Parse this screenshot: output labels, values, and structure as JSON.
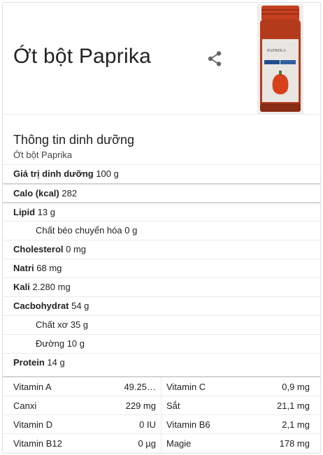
{
  "header": {
    "title": "Ớt bột Paprika",
    "image_label": "PAPRIKA"
  },
  "nutrition": {
    "heading": "Thông tin dinh dưỡng",
    "subheading": "Ớt bột Paprika",
    "rows": [
      {
        "label": "Giá trị dinh dưỡng",
        "value": "100 g",
        "bold": true
      },
      {
        "label": "Calo (kcal)",
        "value": "282",
        "bold": true
      },
      {
        "label": "Lipid",
        "value": "13 g",
        "bold": true
      },
      {
        "label": "Chất béo chuyển hóa",
        "value": "0 g",
        "bold": false
      },
      {
        "label": "Cholesterol",
        "value": "0 mg",
        "bold": true
      },
      {
        "label": "Natri",
        "value": "68 mg",
        "bold": true
      },
      {
        "label": "Kali",
        "value": "2.280 mg",
        "bold": true
      },
      {
        "label": "Cacbohydrat",
        "value": "54 g",
        "bold": true
      },
      {
        "label": "Chất xơ",
        "value": "35 g",
        "bold": false
      },
      {
        "label": "Đường",
        "value": "10 g",
        "bold": false
      },
      {
        "label": "Protein",
        "value": "14 g",
        "bold": true
      }
    ]
  },
  "vitamins": [
    [
      {
        "name": "Vitamin A",
        "value": "49.25…"
      },
      {
        "name": "Vitamin C",
        "value": "0,9 mg"
      }
    ],
    [
      {
        "name": "Canxi",
        "value": "229 mg"
      },
      {
        "name": "Sắt",
        "value": "21,1 mg"
      }
    ],
    [
      {
        "name": "Vitamin D",
        "value": "0 IU"
      },
      {
        "name": "Vitamin B6",
        "value": "2,1 mg"
      }
    ],
    [
      {
        "name": "Vitamin B12",
        "value": "0 µg"
      },
      {
        "name": "Magie",
        "value": "178 mg"
      }
    ]
  ],
  "colors": {
    "border": "#dfe1e5",
    "divider": "#ebebeb",
    "thick_divider": "#d4d4d4",
    "jar_red": "#b33b1c",
    "lid_red": "#c4401f"
  },
  "icons": {
    "share": "share-icon"
  }
}
